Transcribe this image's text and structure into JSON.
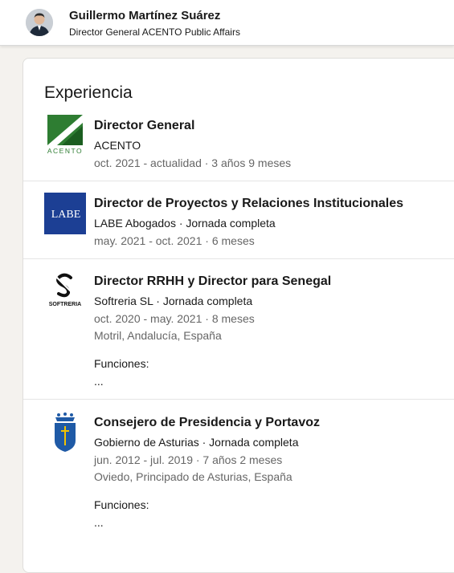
{
  "header": {
    "name": "Guillermo Martínez Suárez",
    "headline": "Director General ACENTO Public Affairs"
  },
  "section": {
    "title": "Experiencia"
  },
  "experiences": [
    {
      "logo": "acento-logo",
      "logo_text": "ACENTO",
      "title": "Director General",
      "company": "ACENTO",
      "dates": "oct. 2021 - actualidad · 3 años 9 meses"
    },
    {
      "logo": "labe-logo",
      "logo_text": "LABE",
      "title": "Director de Proyectos y Relaciones Institucionales",
      "company": "LABE Abogados · Jornada completa",
      "dates": "may. 2021 - oct. 2021 · 6 meses"
    },
    {
      "logo": "softreria-logo",
      "logo_text": "SOFTRERIA",
      "title": "Director RRHH y Director para Senegal",
      "company": "Softreria SL · Jornada completa",
      "dates": "oct. 2020 - may. 2021 · 8 meses",
      "location": "Motril, Andalucía, España",
      "description_label": "Funciones:",
      "description_more": "..."
    },
    {
      "logo": "asturias-coat-of-arms",
      "title": "Consejero de Presidencia y Portavoz",
      "company": "Gobierno de Asturias · Jornada completa",
      "dates": "jun. 2012 - jul. 2019 · 7 años 2 meses",
      "location": "Oviedo, Principado de Asturias, España",
      "description_label": "Funciones:",
      "description_more": "..."
    }
  ],
  "colors": {
    "acento_green": "#2e7d32",
    "labe_blue": "#1c3f94",
    "asturias_blue": "#1f5aa6"
  }
}
